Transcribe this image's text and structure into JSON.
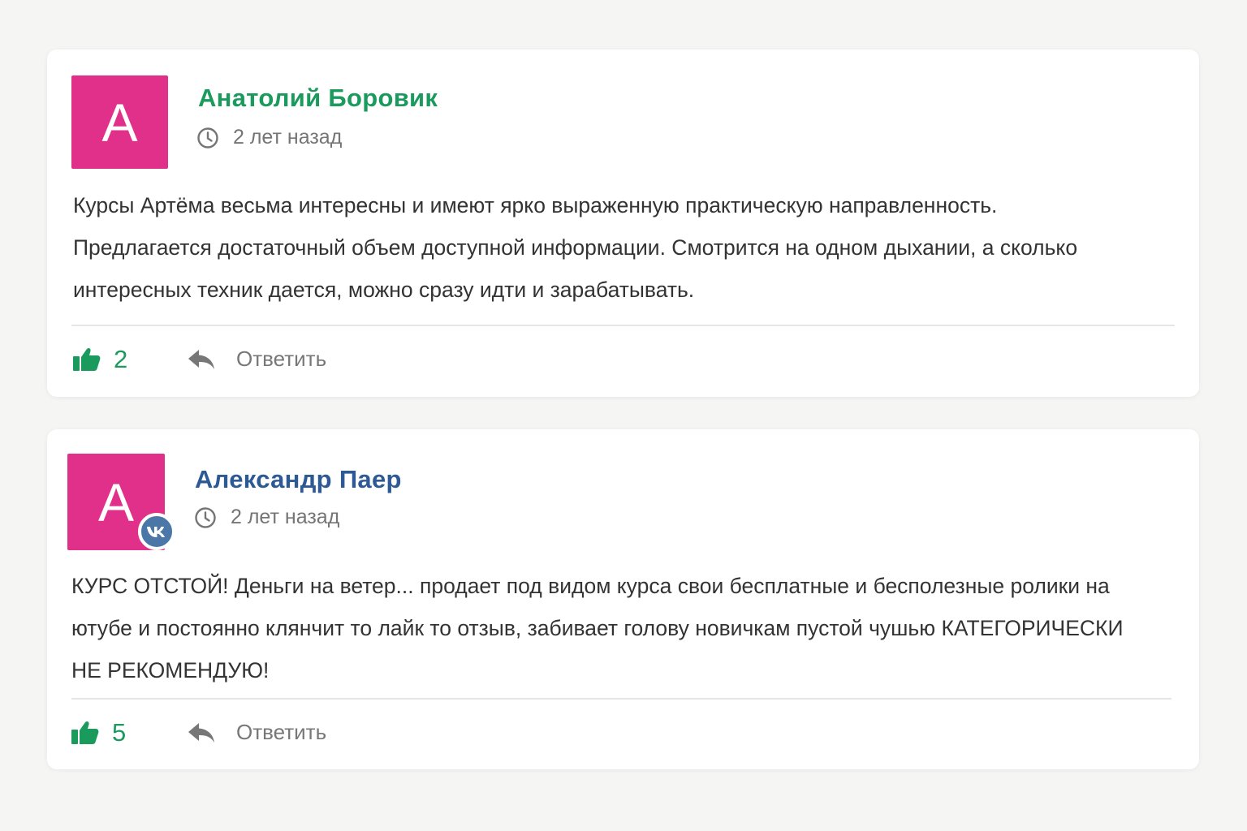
{
  "comments": [
    {
      "avatar_letter": "A",
      "author": "Анатолий Боровик",
      "time": "2 лет назад",
      "text": "Курсы Артёма весьма интересны и имеют ярко выраженную практическую направленность.\nПредлагается достаточный объем доступной информации. Смотрится на одном дыхании, а сколько\nинтересных техник дается, можно сразу идти и зарабатывать.",
      "likes": "2",
      "reply_label": "Ответить",
      "author_color": "#1b9a5e"
    },
    {
      "avatar_letter": "A",
      "author": "Александр Паер",
      "time": "2 лет назад",
      "text": "КУРС ОТСТОЙ! Деньги на ветер... продает под видом курса свои бесплатные и бесполезные ролики на\nютубе и постоянно клянчит то лайк то отзыв, забивает голову новичкам пустой чушью КАТЕГОРИЧЕСКИ\nНЕ РЕКОМЕНДУЮ!",
      "likes": "5",
      "reply_label": "Ответить",
      "author_color": "#2d5a94",
      "badge_icon": "vk-icon"
    }
  ],
  "colors": {
    "avatar_bg": "#e1308a",
    "like_green": "#1b9a5e",
    "vk_blue": "#4a76a8"
  },
  "icons": [
    "clock-icon",
    "thumbs-up-icon",
    "reply-icon",
    "vk-icon"
  ]
}
